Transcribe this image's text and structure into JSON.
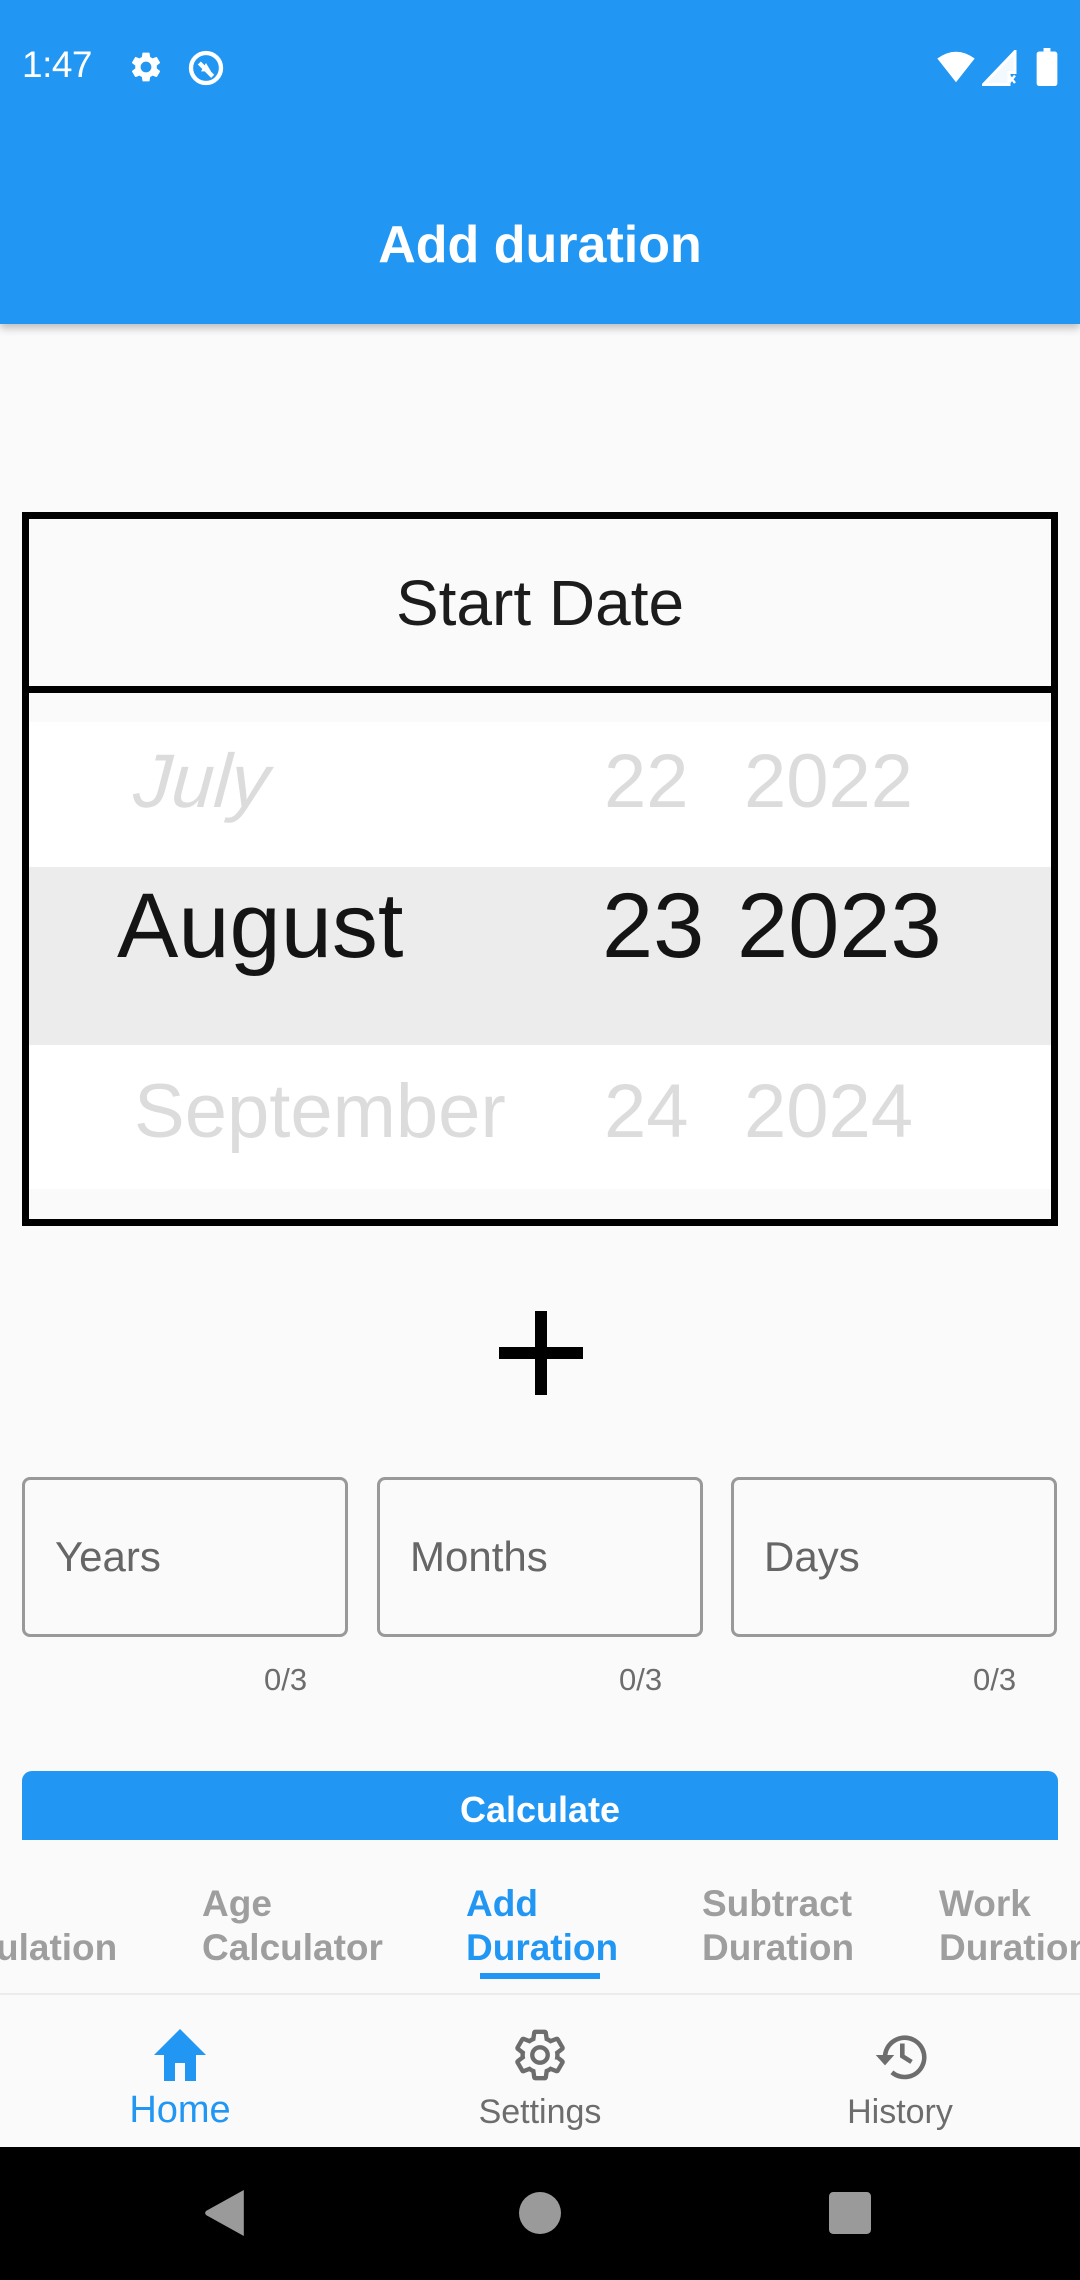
{
  "status_bar": {
    "time": "1:47",
    "left_icons": [
      "settings-gear-icon",
      "data-saver-icon"
    ],
    "right_icons": [
      "wifi-icon",
      "cell-signal-no-data-icon",
      "battery-icon"
    ]
  },
  "appbar": {
    "title": "Add duration",
    "color": "#2196f3"
  },
  "start_date": {
    "label": "Start Date",
    "picker": {
      "previous": {
        "month": "July",
        "day": "22",
        "year": "2022"
      },
      "selected": {
        "month": "August",
        "day": "23",
        "year": "2023"
      },
      "next": {
        "month": "September",
        "day": "24",
        "year": "2024"
      }
    }
  },
  "operator": {
    "icon": "plus-icon"
  },
  "duration_fields": [
    {
      "name": "years",
      "placeholder": "Years",
      "value": "",
      "counter": "0/3"
    },
    {
      "name": "months",
      "placeholder": "Months",
      "value": "",
      "counter": "0/3"
    },
    {
      "name": "days",
      "placeholder": "Days",
      "value": "",
      "counter": "0/3"
    }
  ],
  "calculate_button": {
    "label": "Calculate"
  },
  "tabs": [
    {
      "label": "Calculation",
      "visible_text": "ulation",
      "active": false
    },
    {
      "label": "Age\nCalculator",
      "active": false
    },
    {
      "label": "Add\nDuration",
      "active": true
    },
    {
      "label": "Subtract\nDuration",
      "active": false
    },
    {
      "label": "Work\nDuration",
      "active": false
    }
  ],
  "bottom_nav": [
    {
      "label": "Home",
      "icon": "home-icon",
      "active": true
    },
    {
      "label": "Settings",
      "icon": "settings-icon",
      "active": false
    },
    {
      "label": "History",
      "icon": "history-icon",
      "active": false
    }
  ],
  "system_nav": [
    "back-icon",
    "home-circle-icon",
    "recents-icon"
  ],
  "colors": {
    "accent": "#2196f3",
    "inactive_tab": "#9e9e9e",
    "background": "#fafafa"
  }
}
